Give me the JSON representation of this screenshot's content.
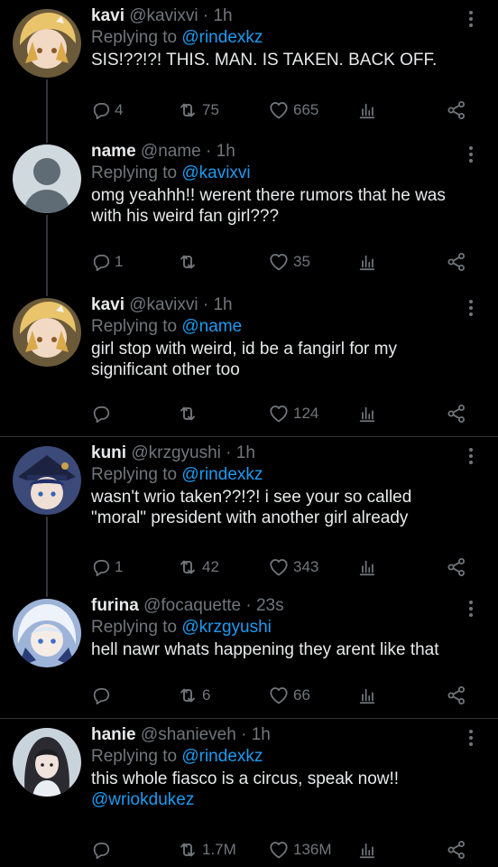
{
  "tweets": [
    {
      "name": "kavi",
      "handle": "@kavixvi",
      "time": "1h",
      "reply_prefix": "Replying to",
      "reply_to": "@rindexkz",
      "text": "SIS!??!?! THIS. MAN. IS TAKEN. BACK OFF.",
      "text_mention": "",
      "replies": "4",
      "retweets": "75",
      "likes": "665"
    },
    {
      "name": "name",
      "handle": "@name",
      "time": "1h",
      "reply_prefix": "Replying to",
      "reply_to": "@kavixvi",
      "text": "omg yeahhh!! werent there rumors that he was with his weird fan girl???",
      "text_mention": "",
      "replies": "1",
      "retweets": "",
      "likes": "35"
    },
    {
      "name": "kavi",
      "handle": "@kavixvi",
      "time": "1h",
      "reply_prefix": "Replying to",
      "reply_to": "@name",
      "text": "girl stop with weird, id be a fangirl for my significant other too",
      "text_mention": "",
      "replies": "",
      "retweets": "",
      "likes": "124"
    },
    {
      "name": "kuni",
      "handle": "@krzgyushi",
      "time": "1h",
      "reply_prefix": "Replying to",
      "reply_to": "@rindexkz",
      "text": "wasn't wrio taken??!?! i see your so called \"moral\" president with another girl already",
      "text_mention": "",
      "replies": "1",
      "retweets": "42",
      "likes": "343"
    },
    {
      "name": "furina",
      "handle": "@focaquette",
      "time": "23s",
      "reply_prefix": "Replying to",
      "reply_to": "@krzgyushi",
      "text": "hell nawr whats happening they arent like that",
      "text_mention": "",
      "replies": "",
      "retweets": "6",
      "likes": "66"
    },
    {
      "name": "hanie",
      "handle": "@shanieveh",
      "time": "1h",
      "reply_prefix": "Replying to",
      "reply_to": "@rindexkz",
      "text": "this whole fiasco is a circus, speak now!!",
      "text_mention": "@wriokdukez",
      "replies": "",
      "retweets": "1.7M",
      "likes": "136M"
    }
  ],
  "colors": {
    "background": "#000000",
    "primary_text": "#e7e9ea",
    "secondary_text": "#71767b",
    "accent": "#1d9bf0",
    "divider": "#2f3336"
  },
  "icons": [
    "reply-icon",
    "retweet-icon",
    "like-icon",
    "views-icon",
    "share-icon",
    "more-icon"
  ]
}
